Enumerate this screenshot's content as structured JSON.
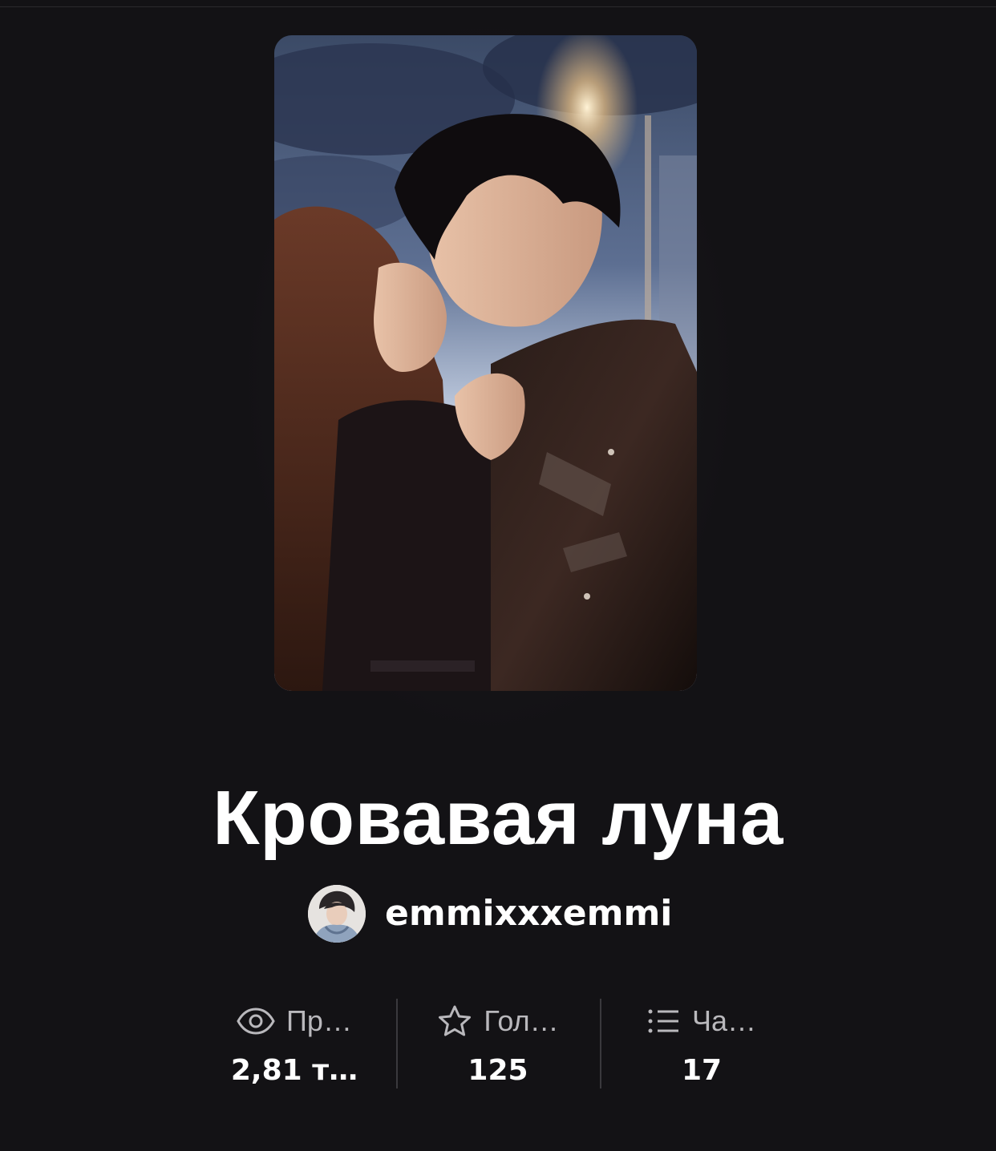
{
  "story": {
    "title": "Кровавая луна",
    "author": "emmixxxemmi"
  },
  "stats": [
    {
      "icon": "eye-icon",
      "label": "Пр…",
      "value": "2,81 т…"
    },
    {
      "icon": "star-icon",
      "label": "Гол…",
      "value": "125"
    },
    {
      "icon": "list-icon",
      "label": "Ча…",
      "value": "17"
    }
  ],
  "colors": {
    "background": "#131215",
    "text": "#ffffff",
    "muted_text": "#b9b8bc",
    "divider": "#3a393d"
  }
}
